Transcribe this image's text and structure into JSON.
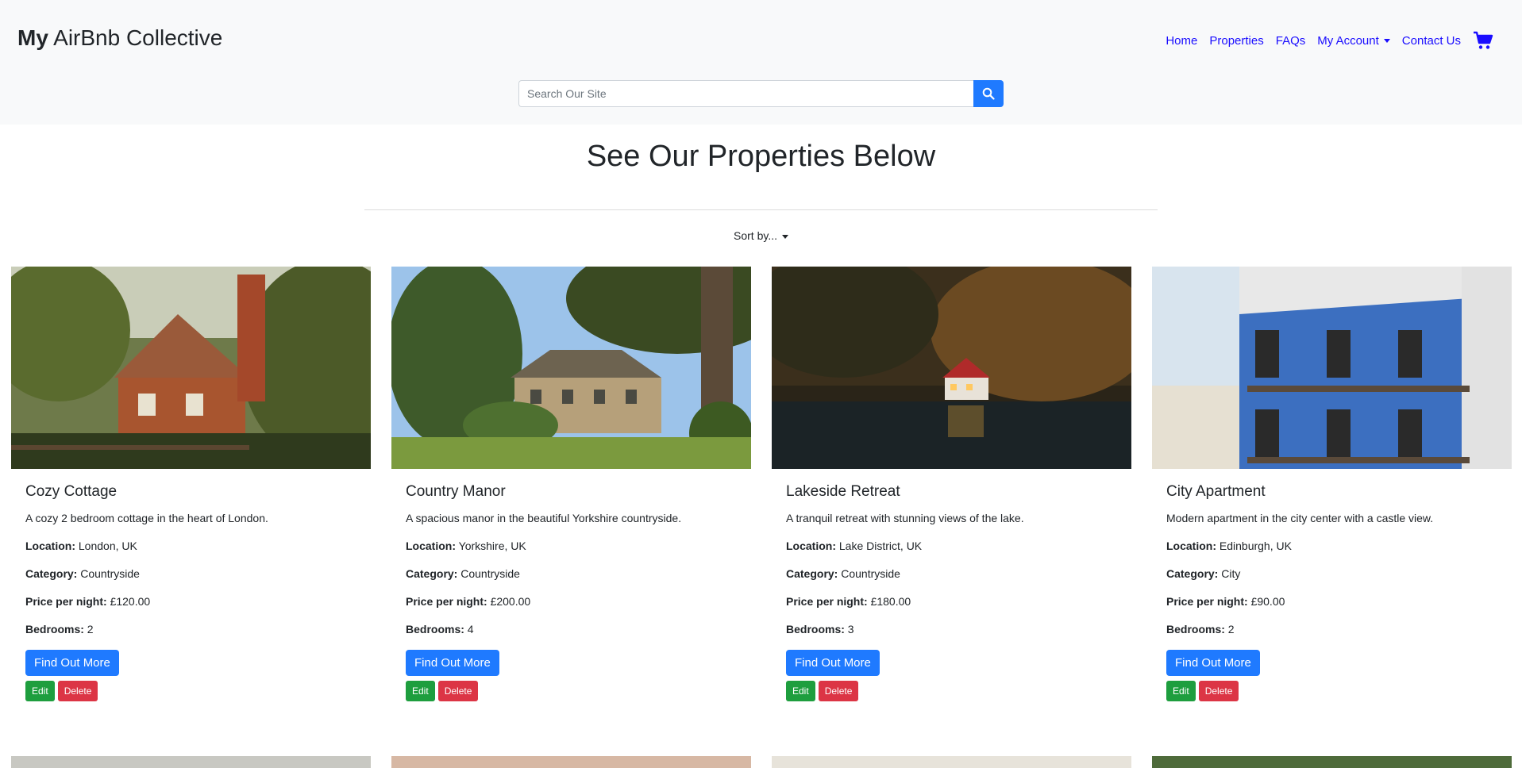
{
  "header": {
    "brand_bold": "My",
    "brand_rest": " AirBnb Collective",
    "nav": [
      "Home",
      "Properties",
      "FAQs",
      "My Account",
      "Contact Us"
    ],
    "search_placeholder": "Search Our Site"
  },
  "main": {
    "title": "See Our Properties Below",
    "sort_label": "Sort by..."
  },
  "labels": {
    "location": "Location:",
    "category": "Category:",
    "price": "Price per night:",
    "bedrooms": "Bedrooms:",
    "more": "Find Out More",
    "edit": "Edit",
    "delete": "Delete"
  },
  "properties": [
    {
      "name": "Cozy Cottage",
      "description": "A cozy 2 bedroom cottage in the heart of London.",
      "location": "London, UK",
      "category": "Countryside",
      "price": "£120.00",
      "bedrooms": "2"
    },
    {
      "name": "Country Manor",
      "description": "A spacious manor in the beautiful Yorkshire countryside.",
      "location": "Yorkshire, UK",
      "category": "Countryside",
      "price": "£200.00",
      "bedrooms": "4"
    },
    {
      "name": "Lakeside Retreat",
      "description": "A tranquil retreat with stunning views of the lake.",
      "location": "Lake District, UK",
      "category": "Countryside",
      "price": "£180.00",
      "bedrooms": "3"
    },
    {
      "name": "City Apartment",
      "description": "Modern apartment in the city center with a castle view.",
      "location": "Edinburgh, UK",
      "category": "City",
      "price": "£90.00",
      "bedrooms": "2"
    }
  ],
  "colors": {
    "primary": "#1f7aff",
    "link": "#1a0dff",
    "success": "#1e9e3e",
    "danger": "#dc3545",
    "header_bg": "#f8f9fa"
  }
}
